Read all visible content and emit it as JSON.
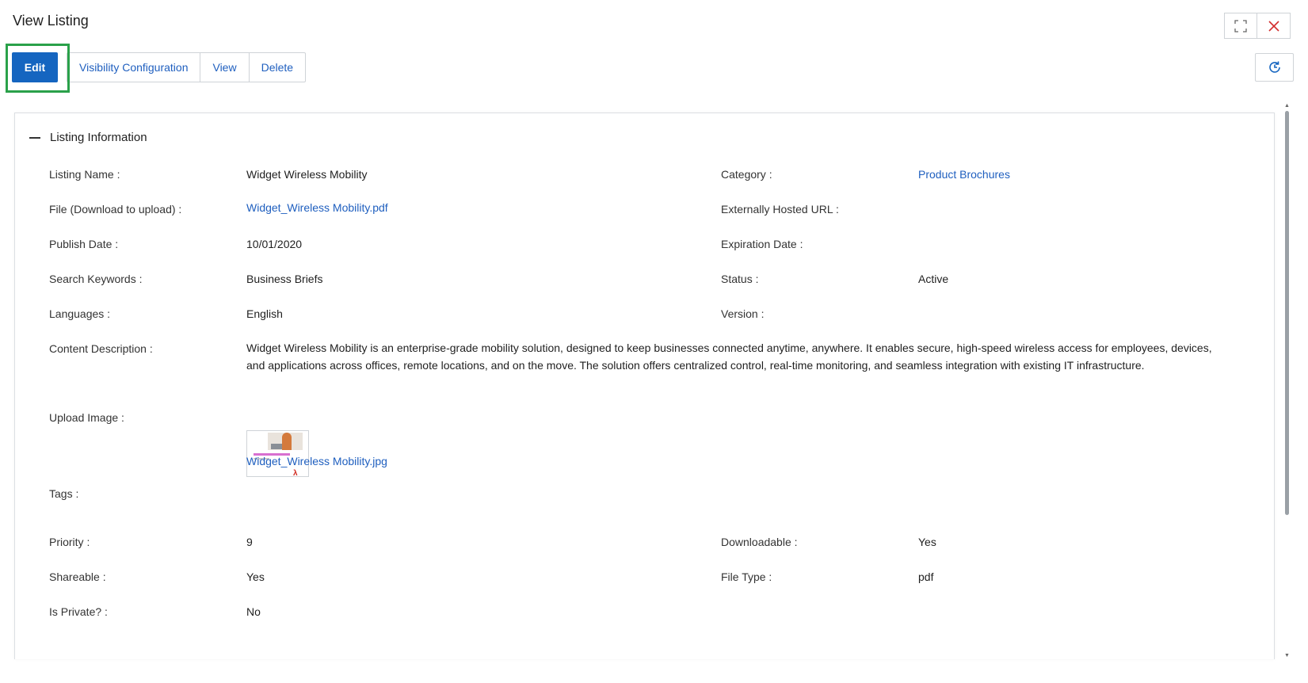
{
  "header": {
    "title": "View Listing"
  },
  "toolbar": {
    "edit_label": "Edit",
    "visibility_label": "Visibility Configuration",
    "view_label": "View",
    "delete_label": "Delete"
  },
  "icons": {
    "expand": "expand-icon",
    "close": "close-icon",
    "history": "history-icon",
    "collapse": "minus-icon"
  },
  "colors": {
    "primary": "#1565c0",
    "link": "#1f5fbf",
    "highlight": "#2aa14a",
    "close_icon": "#d32f2f"
  },
  "section": {
    "title": "Listing Information"
  },
  "fields": {
    "listing_name": {
      "label": "Listing Name :",
      "value": "Widget Wireless Mobility"
    },
    "category": {
      "label": "Category :",
      "value": "Product Brochures"
    },
    "file": {
      "label": "File (Download to upload) :",
      "value": "Widget_Wireless Mobility.pdf"
    },
    "external_url": {
      "label": "Externally Hosted URL :",
      "value": ""
    },
    "publish_date": {
      "label": "Publish Date :",
      "value": "10/01/2020"
    },
    "expiration_date": {
      "label": "Expiration Date :",
      "value": ""
    },
    "search_keywords": {
      "label": "Search Keywords :",
      "value": "Business Briefs"
    },
    "status": {
      "label": "Status :",
      "value": "Active"
    },
    "languages": {
      "label": "Languages :",
      "value": "English"
    },
    "version": {
      "label": "Version :",
      "value": ""
    },
    "content_description": {
      "label": "Content Description :",
      "value": "Widget Wireless Mobility is an enterprise-grade mobility solution, designed to keep businesses connected anytime, anywhere. It enables secure, high-speed wireless access for employees, devices, and applications across offices, remote locations, and on the move. The solution offers centralized control, real-time monitoring, and seamless integration with existing IT infrastructure."
    },
    "upload_image": {
      "label": "Upload Image :",
      "value": "Widget_Wireless Mobility.jpg"
    },
    "tags": {
      "label": "Tags :",
      "value": ""
    },
    "priority": {
      "label": "Priority :",
      "value": "9"
    },
    "downloadable": {
      "label": "Downloadable :",
      "value": "Yes"
    },
    "shareable": {
      "label": "Shareable :",
      "value": "Yes"
    },
    "file_type": {
      "label": "File Type :",
      "value": "pdf"
    },
    "is_private": {
      "label": "Is Private? :",
      "value": "No"
    }
  }
}
